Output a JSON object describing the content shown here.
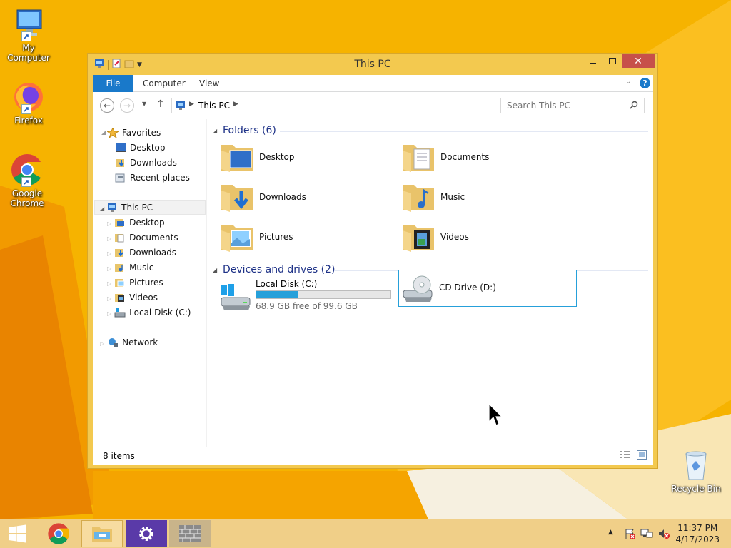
{
  "desktop": {
    "icons": [
      {
        "label": "My Computer",
        "icon": "computer-icon"
      },
      {
        "label": "Firefox",
        "icon": "firefox-icon"
      },
      {
        "label": "Google Chrome",
        "icon": "chrome-icon"
      },
      {
        "label": "Recycle Bin",
        "icon": "recycle-bin-icon"
      }
    ],
    "colors": {
      "wallpaper_base": "#f7b500",
      "wallpaper_dark": "#e37c00",
      "wallpaper_light": "#ffd35c"
    }
  },
  "window": {
    "title": "This PC",
    "ribbon_tabs": [
      "File",
      "Computer",
      "View"
    ],
    "address": {
      "path": "This PC"
    },
    "search": {
      "placeholder": "Search This PC"
    },
    "colors": {
      "frame": "#f3c94f",
      "close": "#c7504a",
      "file_tab": "#1979ca",
      "header": "#1e3287",
      "selection": "#26a0da"
    }
  },
  "navpane": {
    "favorites": {
      "label": "Favorites",
      "items": [
        "Desktop",
        "Downloads",
        "Recent places"
      ]
    },
    "thispc": {
      "label": "This PC",
      "items": [
        "Desktop",
        "Documents",
        "Downloads",
        "Music",
        "Pictures",
        "Videos",
        "Local Disk (C:)"
      ]
    },
    "network": {
      "label": "Network"
    }
  },
  "main": {
    "folders_header": "Folders (6)",
    "folders": [
      {
        "label": "Desktop",
        "icon": "desktop-folder-icon"
      },
      {
        "label": "Documents",
        "icon": "documents-folder-icon"
      },
      {
        "label": "Downloads",
        "icon": "downloads-folder-icon"
      },
      {
        "label": "Music",
        "icon": "music-folder-icon"
      },
      {
        "label": "Pictures",
        "icon": "pictures-folder-icon"
      },
      {
        "label": "Videos",
        "icon": "videos-folder-icon"
      }
    ],
    "drives_header": "Devices and drives (2)",
    "drives": [
      {
        "label": "Local Disk (C:)",
        "free_text": "68.9 GB free of 99.6 GB",
        "used_fraction": 0.308
      },
      {
        "label": "CD Drive (D:)"
      }
    ]
  },
  "statusbar": {
    "items_count": "8 items"
  },
  "taskbar": {
    "buttons": [
      "start-button",
      "chrome-taskbar-button",
      "file-explorer-taskbar-button",
      "settings-taskbar-button",
      "app-taskbar-button"
    ],
    "time": "11:37 PM",
    "date": "4/17/2023"
  }
}
